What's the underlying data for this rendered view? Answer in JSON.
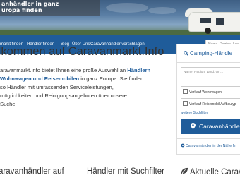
{
  "header": {
    "banner_lines": [
      "anhändler in ganz",
      "uropa finden"
    ]
  },
  "nav": {
    "items": [
      {
        "label": "markt finden"
      },
      {
        "label": "Händler finden"
      },
      {
        "label": "Blog"
      },
      {
        "label": "Über Uns"
      },
      {
        "label": "Caravanhändler vorschlagen"
      }
    ],
    "search_placeholder": "Name, Region, Lan"
  },
  "main": {
    "title": "llkommen auf Caravanmarkt.Info",
    "intro_lines": [
      {
        "parts": [
          "aravanmarkt.Info bietet Ihnen eine große Auswahl an ",
          "Händlern"
        ],
        "bold": [
          false,
          true
        ]
      },
      {
        "parts": [
          "Wohnwagen und Reisemobilen",
          " in ganz Europa. Sie finden"
        ],
        "bold": [
          true,
          false
        ]
      },
      {
        "parts": [
          "so Händler mit umfassenden Serviceleistungen,"
        ],
        "bold": [
          false
        ]
      },
      {
        "parts": [
          "möglichkeiten und Reinigungsangeboten über unsere"
        ],
        "bold": [
          false
        ]
      },
      {
        "parts": [
          "Suche."
        ],
        "bold": [
          false
        ]
      }
    ]
  },
  "sidebar": {
    "title": "Camping-Händle",
    "search_placeholder": "Name, Region, Land, Ort...",
    "dropdown_value": "",
    "checkbox1_label": "Verkauf Wohnwagen",
    "checkbox2_label": "Verkauf Reisemobil Aufbautyp",
    "more_filters": "weitere Suchfilter",
    "button_label": "Caravanhändle",
    "footer_link": "Caravanhändler in der Nähe fin"
  },
  "bottom": {
    "headings": [
      "aravanhändler auf",
      "Händler mit Suchfilter",
      "Aktuelle Carava"
    ]
  },
  "colors": {
    "nav_blue": "#1f5c9a",
    "accent": "#1f5c9a"
  },
  "icons": {
    "search": "search-icon",
    "map_marker": "map-marker-icon",
    "location": "location-icon",
    "leaf": "leaf-icon"
  }
}
